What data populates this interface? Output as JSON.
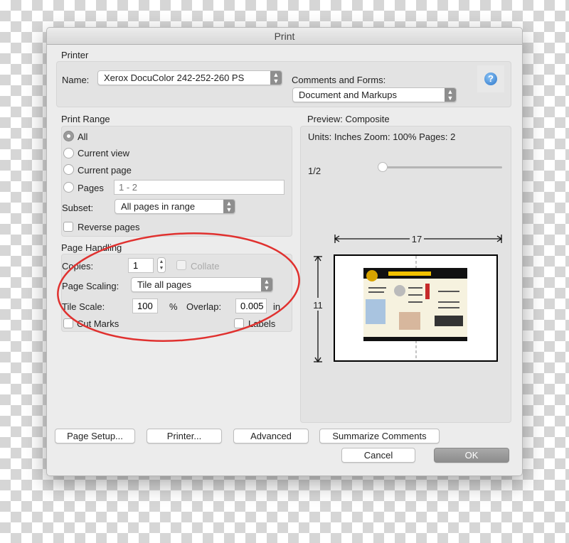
{
  "window": {
    "title": "Print"
  },
  "printer": {
    "section_label": "Printer",
    "name_label": "Name:",
    "name_value": "Xerox DocuColor 242-252-260 PS",
    "comments_label": "Comments and Forms:",
    "comments_value": "Document and Markups",
    "help_icon": "question-mark-icon"
  },
  "print_range": {
    "section_label": "Print Range",
    "options": [
      {
        "label": "All",
        "selected": true
      },
      {
        "label": "Current view",
        "selected": false
      },
      {
        "label": "Current page",
        "selected": false
      },
      {
        "label": "Pages",
        "selected": false
      }
    ],
    "pages_placeholder": "1 - 2",
    "subset_label": "Subset:",
    "subset_value": "All pages in range",
    "reverse_label": "Reverse pages",
    "reverse_checked": false
  },
  "page_handling": {
    "section_label": "Page Handling",
    "copies_label": "Copies:",
    "copies_value": "1",
    "collate_label": "Collate",
    "scaling_label": "Page Scaling:",
    "scaling_value": "Tile all pages",
    "tile_scale_label": "Tile Scale:",
    "tile_scale_value": "100",
    "percent": "%",
    "overlap_label": "Overlap:",
    "overlap_value": "0.005",
    "overlap_unit": "in",
    "cut_marks_label": "Cut Marks",
    "labels_label": "Labels",
    "annotation_color": "#e0312f"
  },
  "preview": {
    "section_label": "Preview: Composite",
    "info": "Units: Inches Zoom: 100% Pages: 2",
    "page_indicator": "1/2",
    "slider_value": 0,
    "width_dim": "17",
    "height_dim": "11"
  },
  "buttons": {
    "page_setup": "Page Setup...",
    "printer": "Printer...",
    "advanced": "Advanced",
    "summarize": "Summarize Comments",
    "cancel": "Cancel",
    "ok": "OK"
  }
}
